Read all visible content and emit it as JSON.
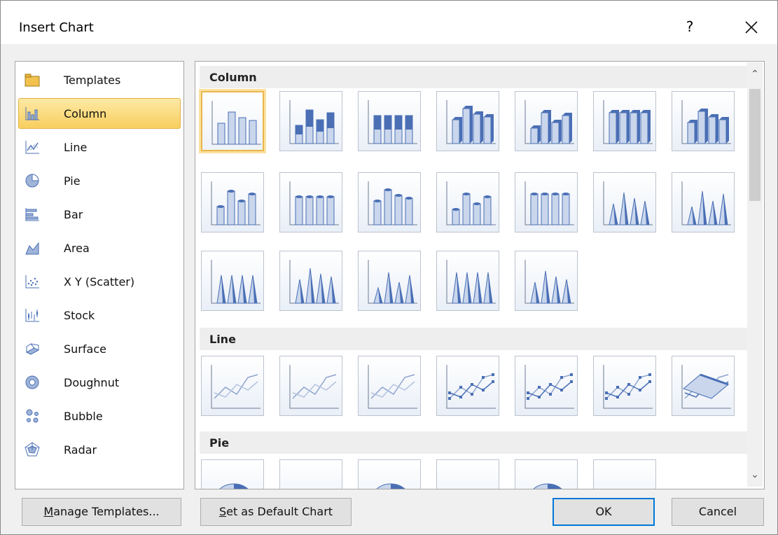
{
  "window": {
    "title": "Insert Chart",
    "help_glyph": "?"
  },
  "chart_types": [
    {
      "label": "Templates",
      "icon": "folder-icon",
      "selected": false
    },
    {
      "label": "Column",
      "icon": "column-chart-icon",
      "selected": true
    },
    {
      "label": "Line",
      "icon": "line-chart-icon",
      "selected": false
    },
    {
      "label": "Pie",
      "icon": "pie-chart-icon",
      "selected": false
    },
    {
      "label": "Bar",
      "icon": "bar-chart-icon",
      "selected": false
    },
    {
      "label": "Area",
      "icon": "area-chart-icon",
      "selected": false
    },
    {
      "label": "X Y (Scatter)",
      "icon": "scatter-chart-icon",
      "selected": false
    },
    {
      "label": "Stock",
      "icon": "stock-chart-icon",
      "selected": false
    },
    {
      "label": "Surface",
      "icon": "surface-chart-icon",
      "selected": false
    },
    {
      "label": "Doughnut",
      "icon": "doughnut-chart-icon",
      "selected": false
    },
    {
      "label": "Bubble",
      "icon": "bubble-chart-icon",
      "selected": false
    },
    {
      "label": "Radar",
      "icon": "radar-chart-icon",
      "selected": false
    }
  ],
  "sections": [
    {
      "title": "Column",
      "thumbnail_count": 19,
      "selected_index": 0
    },
    {
      "title": "Line",
      "thumbnail_count": 7
    },
    {
      "title": "Pie",
      "thumbnail_count": 6
    }
  ],
  "buttons": {
    "manage_templates_mnemonic": "M",
    "manage_templates_rest": "anage Templates...",
    "set_default_mnemonic": "S",
    "set_default_rest": "et as Default Chart",
    "ok": "OK",
    "cancel": "Cancel"
  },
  "colors": {
    "selection_fill": "#f8cf5e",
    "selection_border": "#e3b247",
    "default_button_border": "#0078d7",
    "chart_blue": "#4a6fb5"
  }
}
